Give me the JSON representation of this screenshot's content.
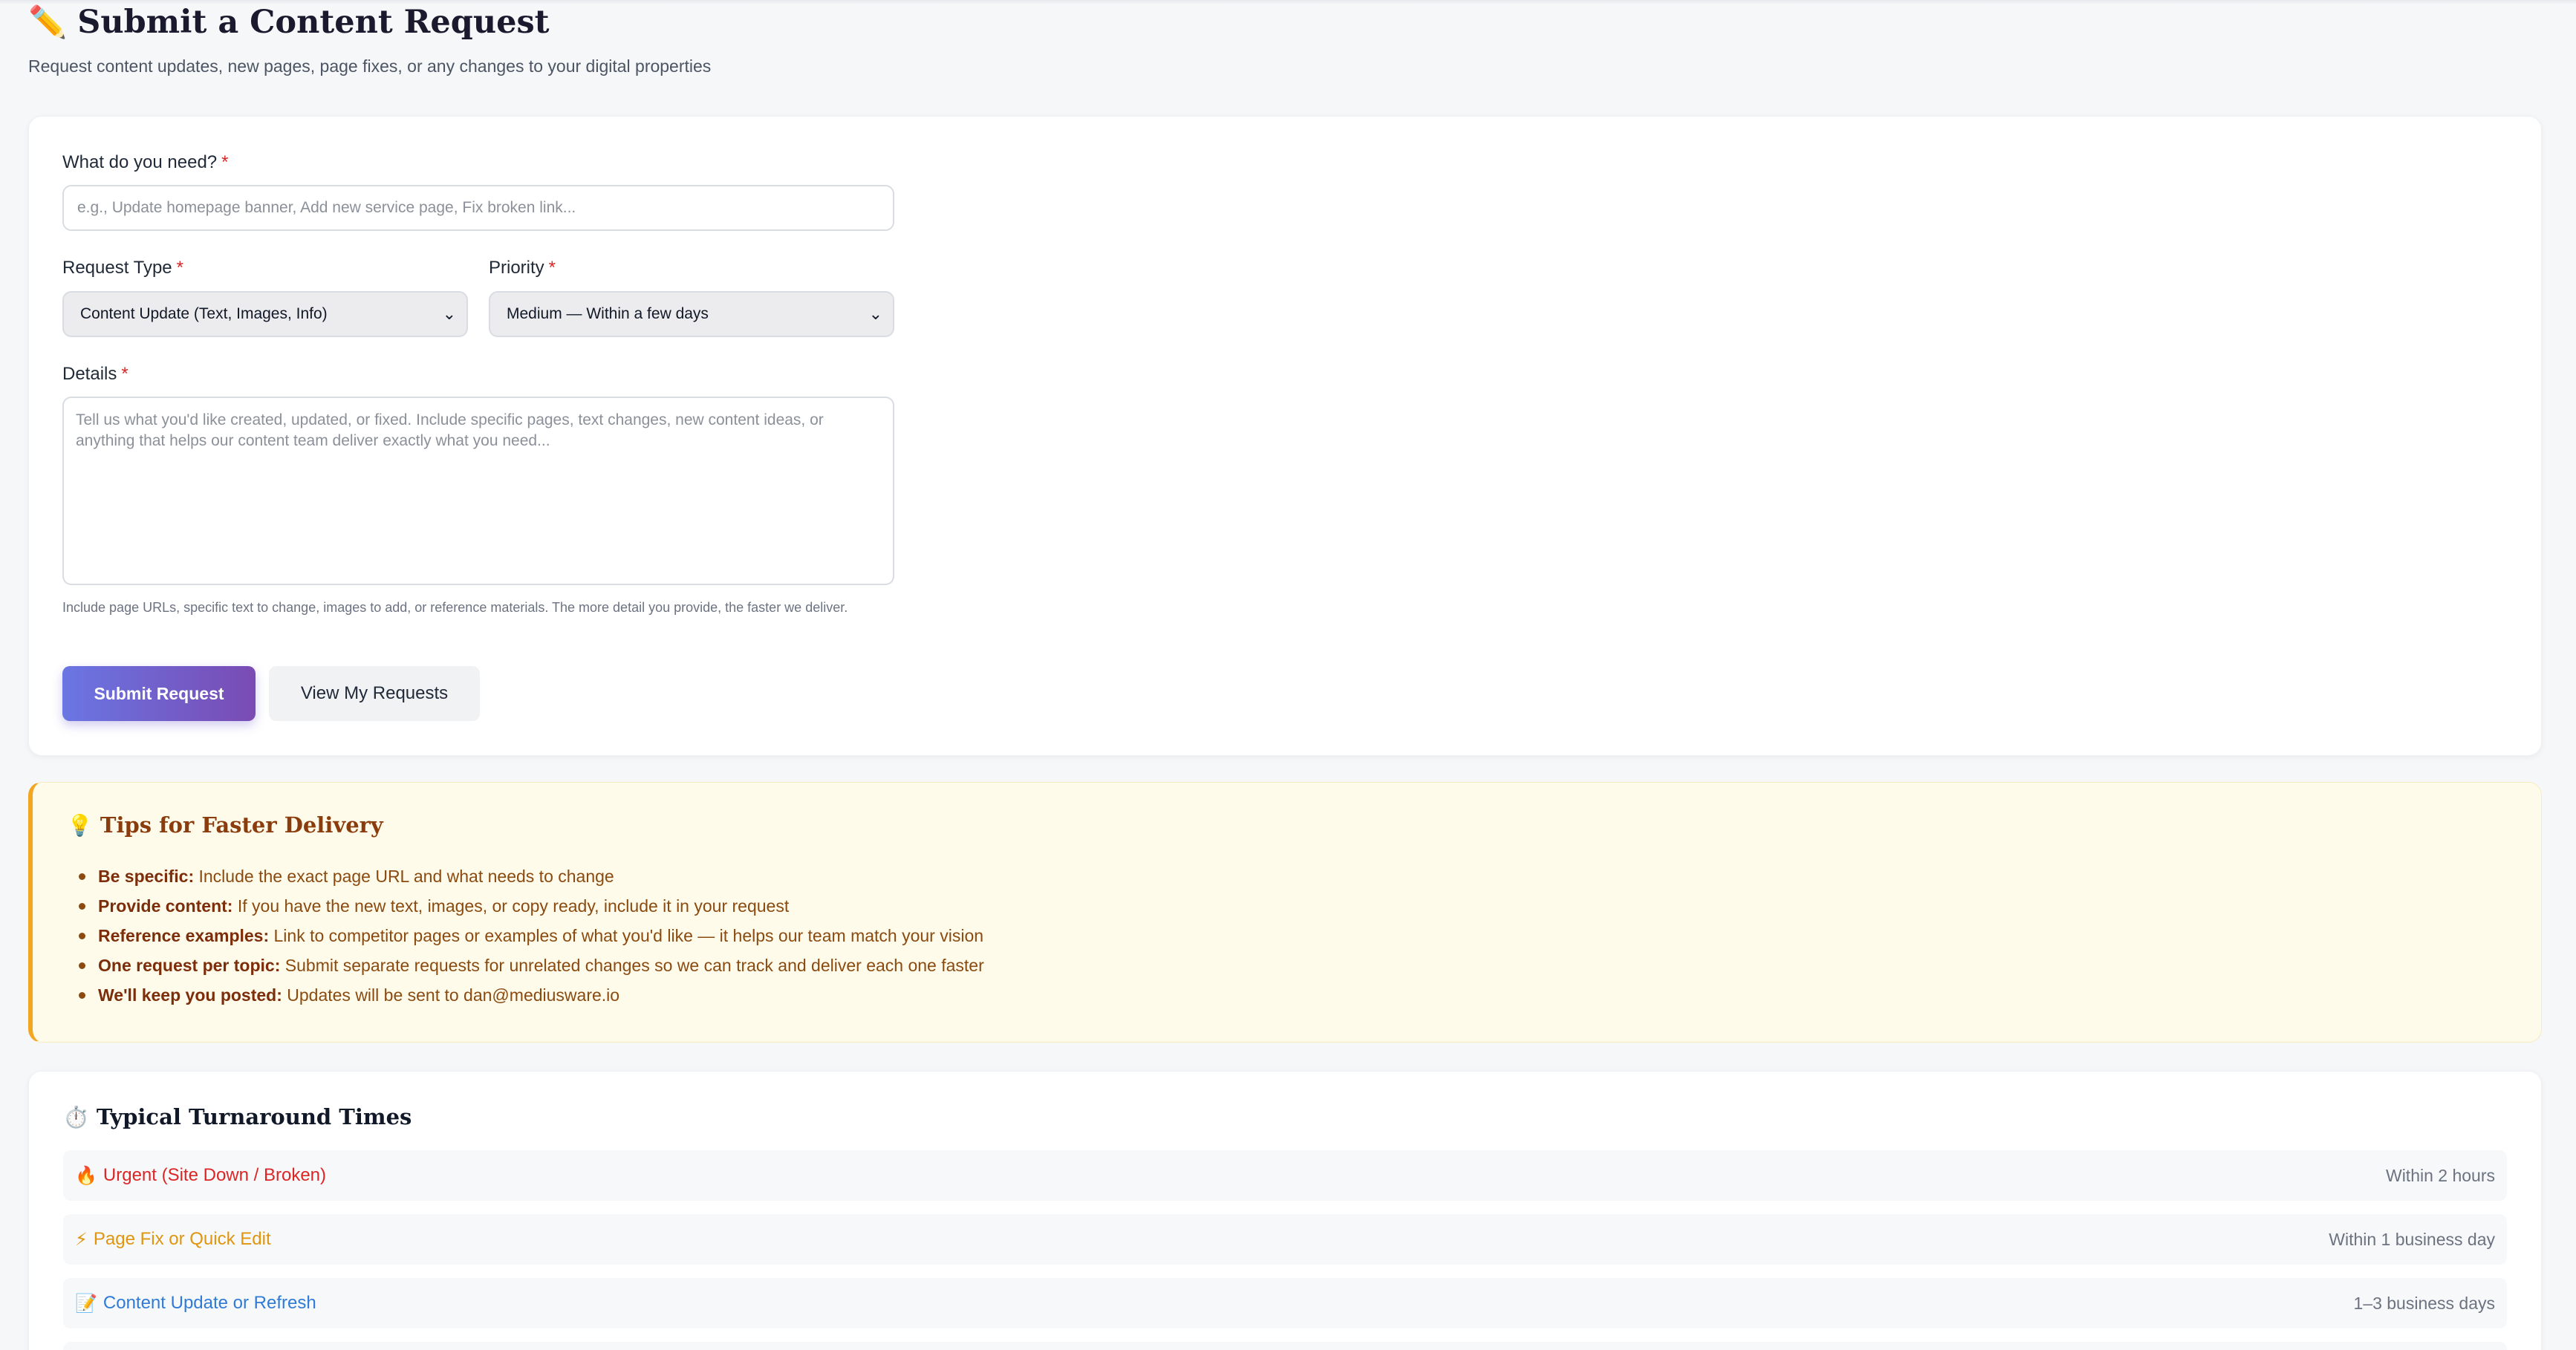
{
  "header": {
    "title_icon": "pencil-icon",
    "title": "Submit a Content Request",
    "subtitle": "Request content updates, new pages, page fixes, or any changes to your digital properties"
  },
  "form": {
    "need_label": "What do you need?",
    "need_placeholder": "e.g., Update homepage banner, Add new service page, Fix broken link...",
    "type_label": "Request Type",
    "type_value": "Content Update (Text, Images, Info)",
    "priority_label": "Priority",
    "priority_value": "Medium — Within a few days",
    "details_label": "Details",
    "details_placeholder": "Tell us what you'd like created, updated, or fixed. Include specific pages, text changes, new content ideas, or anything that helps our content team deliver exactly what you need...",
    "help_text": "Include page URLs, specific text to change, images to add, or reference materials. The more detail you provide, the faster we deliver.",
    "required_mark": "*",
    "submit_label": "Submit Request",
    "view_label": "View My Requests"
  },
  "tips": {
    "icon": "lightbulb-icon",
    "title": "Tips for Faster Delivery",
    "items": [
      {
        "label": "Be specific:",
        "text": " Include the exact page URL and what needs to change"
      },
      {
        "label": "Provide content:",
        "text": " If you have the new text, images, or copy ready, include it in your request"
      },
      {
        "label": "Reference examples:",
        "text": " Link to competitor pages or examples of what you'd like — it helps our team match your vision"
      },
      {
        "label": "One request per topic:",
        "text": " Submit separate requests for unrelated changes so we can track and deliver each one faster"
      },
      {
        "label": "We'll keep you posted:",
        "text": " Updates will be sent to dan@mediusware.io"
      }
    ]
  },
  "turnaround": {
    "icon": "stopwatch-icon",
    "title": "Typical Turnaround Times",
    "rows": [
      {
        "icon": "fire-icon",
        "glyph": "🔥",
        "name": "Urgent (Site Down / Broken)",
        "time": "Within 2 hours",
        "color": "#dc2626"
      },
      {
        "icon": "lightning-icon",
        "glyph": "⚡",
        "name": "Page Fix or Quick Edit",
        "time": "Within 1 business day",
        "color": "#e0950f"
      },
      {
        "icon": "memo-icon",
        "glyph": "📝",
        "name": "Content Update or Refresh",
        "time": "1–3 business days",
        "color": "#2f7bd6"
      }
    ]
  },
  "colors": {
    "accent_start": "#6a76e3",
    "accent_end": "#7a4bb3",
    "required": "#dc2626",
    "tips_border": "#f3a622",
    "tips_bg": "#fffbea"
  }
}
